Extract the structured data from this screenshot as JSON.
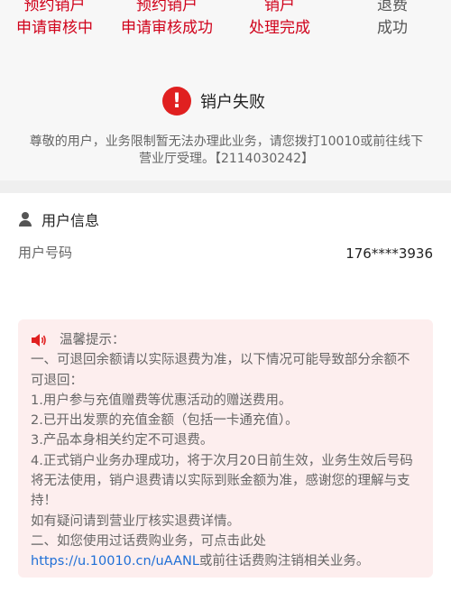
{
  "steps": [
    {
      "line1": "预约销户",
      "line2": "申请审核中"
    },
    {
      "line1": "预约销户",
      "line2": "申请审核成功"
    },
    {
      "line1": "销户",
      "line2": "处理完成"
    },
    {
      "line1": "退费",
      "line2": "成功"
    }
  ],
  "status": {
    "title": "销户失败",
    "description": "尊敬的用户，业务限制暂无法办理此业务，请您拨打10010或前往线下营业厅受理。【2114030242】"
  },
  "user_info": {
    "header": "用户信息",
    "number_label": "用户号码",
    "number_value": "176****3936"
  },
  "tips": {
    "title": "温馨提示：",
    "lines": [
      "一、可退回余额请以实际退费为准，以下情况可能导致部分余额不可退回：",
      "1.用户参与充值赠费等优惠活动的赠送费用。",
      "2.已开出发票的充值金额（包括一卡通充值）。",
      "3.产品本身相关约定不可退费。",
      "4.正式销户业务办理成功，将于次月20日前生效，业务生效后号码将无法使用，销户退费请以实际到账金额为准，感谢您的理解与支持！",
      "如有疑问请到营业厅核实退费详情。",
      "二、如您使用过话费购业务，可点击此处"
    ],
    "link_text": "https://u.10010.cn/uAANL",
    "link_suffix": "或前往话费购注销相关业务。"
  },
  "colors": {
    "accent_red": "#d0021b",
    "icon_red": "#e02020",
    "link_blue": "#1f6fd6",
    "tips_bg": "#fdeeee"
  },
  "icons": [
    "warning-icon",
    "user-icon",
    "speaker-icon"
  ]
}
